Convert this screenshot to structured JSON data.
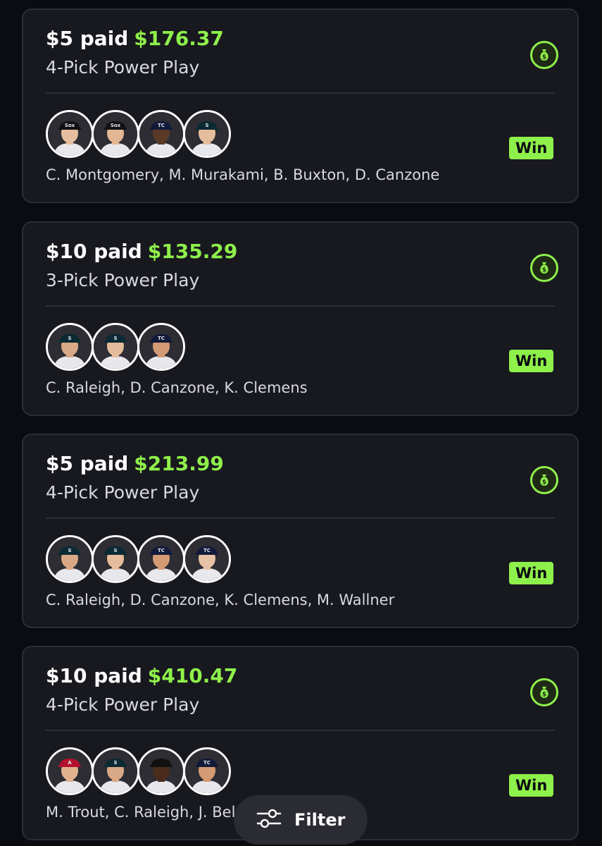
{
  "entries": [
    {
      "paid_label": "$5 paid",
      "payout": "$176.37",
      "play_type": "4-Pick Power Play",
      "status": "Win",
      "players": "C. Montgomery, M. Murakami, B. Buxton, D. Canzone",
      "avatars": [
        {
          "cap": "#111111",
          "logo": "Sox",
          "skin": "#e7bfa0"
        },
        {
          "cap": "#111111",
          "logo": "Sox",
          "skin": "#e3b693"
        },
        {
          "cap": "#121a3a",
          "logo": "TC",
          "skin": "#5a3a26"
        },
        {
          "cap": "#0b2a33",
          "logo": "S",
          "skin": "#e6bd9c"
        }
      ]
    },
    {
      "paid_label": "$10 paid",
      "payout": "$135.29",
      "play_type": "3-Pick Power Play",
      "status": "Win",
      "players": "C. Raleigh, D. Canzone, K. Clemens",
      "avatars": [
        {
          "cap": "#0b2a33",
          "logo": "S",
          "skin": "#d9a886"
        },
        {
          "cap": "#0b2a33",
          "logo": "S",
          "skin": "#e6bd9c"
        },
        {
          "cap": "#121a3a",
          "logo": "TC",
          "skin": "#d49a74"
        }
      ]
    },
    {
      "paid_label": "$5 paid",
      "payout": "$213.99",
      "play_type": "4-Pick Power Play",
      "status": "Win",
      "players": "C. Raleigh, D. Canzone, K. Clemens, M. Wallner",
      "avatars": [
        {
          "cap": "#0b2a33",
          "logo": "S",
          "skin": "#d9a886"
        },
        {
          "cap": "#0b2a33",
          "logo": "S",
          "skin": "#e6bd9c"
        },
        {
          "cap": "#121a3a",
          "logo": "TC",
          "skin": "#d49a74"
        },
        {
          "cap": "#121a3a",
          "logo": "TC",
          "skin": "#e7c2a6"
        }
      ]
    },
    {
      "paid_label": "$10 paid",
      "payout": "$410.47",
      "play_type": "4-Pick Power Play",
      "status": "Win",
      "players": "M. Trout, C. Raleigh, J. Bel",
      "avatars": [
        {
          "cap": "#b3122e",
          "logo": "A",
          "skin": "#e2b28f"
        },
        {
          "cap": "#0b2a33",
          "logo": "S",
          "skin": "#d9a886"
        },
        {
          "cap": "#111111",
          "logo": "",
          "skin": "#4a2c1c"
        },
        {
          "cap": "#121a3a",
          "logo": "TC",
          "skin": "#d49a74"
        }
      ]
    }
  ],
  "filter": {
    "label": "Filter",
    "icon": "sliders-icon"
  },
  "colors": {
    "accent": "#8ef04a",
    "card_bg": "#18181f",
    "page_bg": "#0b0b12"
  }
}
